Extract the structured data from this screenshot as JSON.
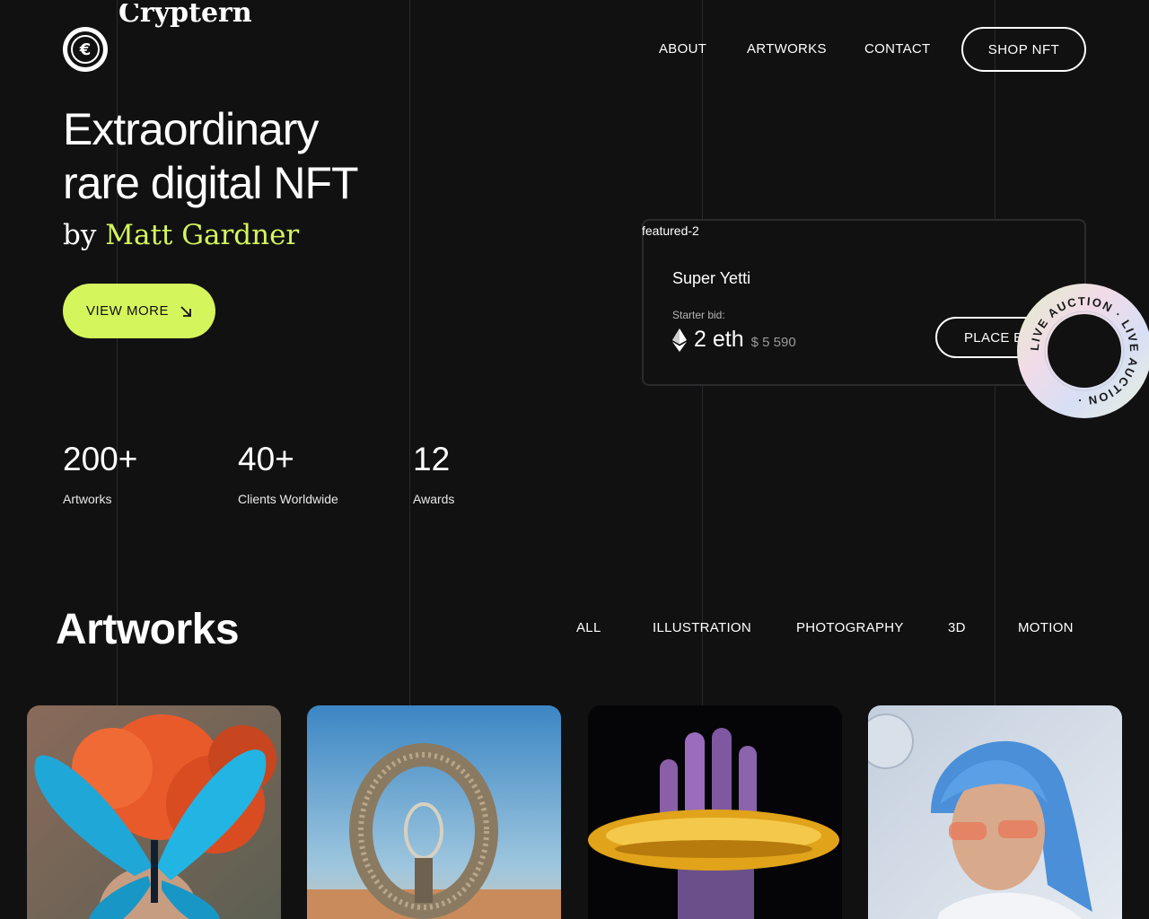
{
  "brand": {
    "logo_text": "Cryptern",
    "logo_glyph": "€",
    "logo_icon": "coin-logo-icon"
  },
  "nav": {
    "items": [
      "ABOUT",
      "ARTWORKS",
      "CONTACT"
    ],
    "cta": "SHOP NFT"
  },
  "hero": {
    "title_line1": "Extraordinary",
    "title_line2": "rare digital NFT",
    "by": "by",
    "author": "Matt Gardner",
    "button": "VIEW MORE",
    "accent_color": "#d5f55c"
  },
  "stats": [
    {
      "value": "200+",
      "label": "Artworks"
    },
    {
      "value": "40+",
      "label": "Clients Worldwide"
    },
    {
      "value": "12",
      "label": "Awards"
    }
  ],
  "featured": {
    "caption": "featured-2",
    "name": "Super Yetti",
    "bid_label": "Starter bid:",
    "eth_value": "2 eth",
    "usd_value": "$ 5 590",
    "button": "PLACE BID",
    "badge_text": "LIVE AUCTION · LIVE AUCTION ·"
  },
  "artworks": {
    "title": "Artworks",
    "filters": [
      "ALL",
      "ILLUSTRATION",
      "PHOTOGRAPHY",
      "3D",
      "MOTION"
    ],
    "tiles": [
      {
        "name": "butterfly-portrait"
      },
      {
        "name": "desert-ring-structure"
      },
      {
        "name": "chrome-hand"
      },
      {
        "name": "blue-hair-portrait"
      }
    ]
  },
  "colors": {
    "background": "#111112",
    "text": "#ffffff",
    "accent": "#d5f55c",
    "line": "#2a2a2c"
  }
}
